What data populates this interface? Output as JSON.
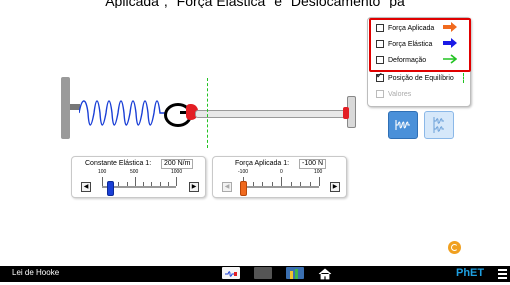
{
  "caption": "Aplicada\", \"Força Elástica\" e \"Deslocamento\" pa",
  "panel": {
    "items": [
      {
        "label": "Força Aplicada",
        "checked": false,
        "enabled": true
      },
      {
        "label": "Força Elástica",
        "checked": false,
        "enabled": true
      },
      {
        "label": "Deformação",
        "checked": false,
        "enabled": true
      },
      {
        "label": "Posição de Equilíbrio",
        "checked": true,
        "enabled": true
      },
      {
        "label": "Valores",
        "checked": false,
        "enabled": false
      }
    ]
  },
  "spring_constant": {
    "title": "Constante Elástica 1:",
    "value": "200 N/m",
    "ticks": [
      "100",
      "500",
      "1000"
    ],
    "level": 200,
    "min": 100,
    "max": 1000
  },
  "applied_force": {
    "title": "Força Aplicada 1:",
    "value": "-100 N",
    "ticks": [
      "-100",
      "0",
      "100"
    ],
    "level": -100,
    "min": -100,
    "max": 100
  },
  "navbar": {
    "title": "Lei de Hooke",
    "brand": "PhET"
  },
  "colors": {
    "applied_force_arrow": "#f06a1e",
    "spring_force_arrow": "#1a1ae6",
    "displacement_arrow": "#22c322",
    "equilibrium_line": "#22c322",
    "spring": "#1a3fd6",
    "highlight_box": "#e00000"
  },
  "icons": {
    "reset": "reset-all-icon",
    "home": "home-icon"
  }
}
